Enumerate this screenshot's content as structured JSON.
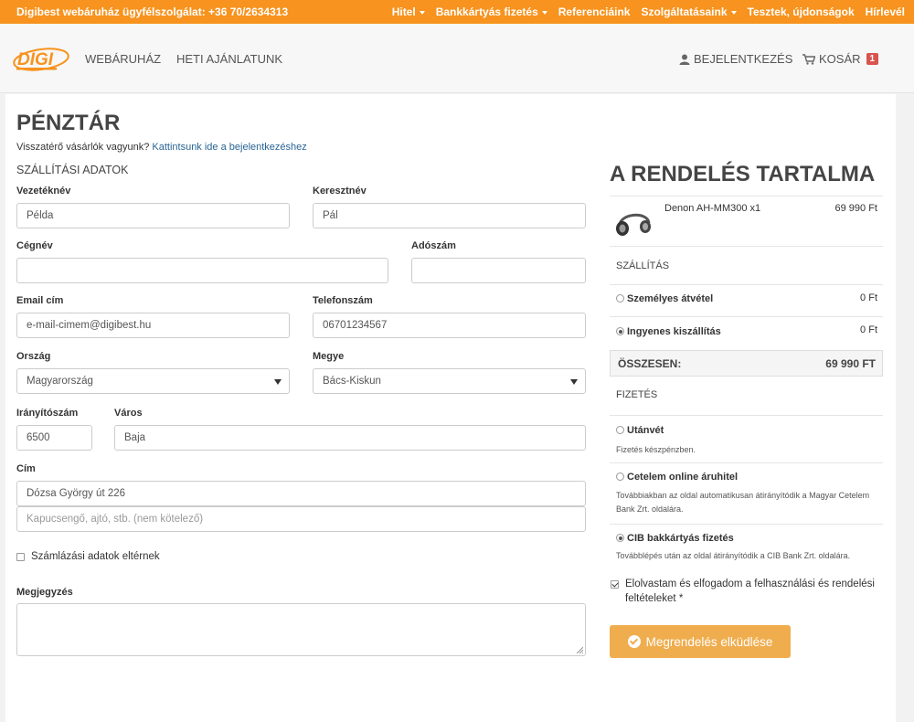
{
  "topbar": {
    "hotline": "Digibest webáruház ügyfélszolgálat: +36 70/2634313",
    "links": [
      {
        "label": "Hitel",
        "dropdown": true
      },
      {
        "label": "Bankkártyás fizetés",
        "dropdown": true
      },
      {
        "label": "Referenciáink",
        "dropdown": false
      },
      {
        "label": "Szolgáltatásaink",
        "dropdown": true
      },
      {
        "label": "Tesztek, újdonságok",
        "dropdown": false
      },
      {
        "label": "Hírlevél",
        "dropdown": false
      }
    ]
  },
  "nav": {
    "logo": "DIGI",
    "shop": "Webáruház",
    "weekly": "Heti ajánlatunk",
    "login": "Bejelentkezés",
    "cart": "Kosár",
    "cart_count": "1"
  },
  "checkout": {
    "title": "Pénztár",
    "returning_text": "Visszatérő vásárlók vagyunk?",
    "returning_link": "Kattintsunk ide a bejelentkezéshez",
    "shipping_title": "Szállítási adatok"
  },
  "form": {
    "lastname": {
      "label": "Vezetéknév",
      "value": "Példa"
    },
    "firstname": {
      "label": "Keresztnév",
      "value": "Pál"
    },
    "company": {
      "label": "Cégnév",
      "value": ""
    },
    "taxnumber": {
      "label": "Adószám",
      "value": ""
    },
    "email": {
      "label": "Email cím",
      "value": "e-mail-cimem@digibest.hu"
    },
    "phone": {
      "label": "Telefonszám",
      "value": "06701234567"
    },
    "country": {
      "label": "Ország",
      "value": "Magyarország"
    },
    "county": {
      "label": "Megye",
      "value": "Bács-Kiskun"
    },
    "zip": {
      "label": "Irányítószám",
      "value": "6500"
    },
    "city": {
      "label": "Város",
      "value": "Baja"
    },
    "address": {
      "label": "Cím",
      "value": "Dózsa György út 226",
      "placeholder2": "Kapucsengő, ajtó, stb. (nem kötelező)"
    },
    "billing_diff": "Számlázási adatok eltérnek",
    "note": {
      "label": "Megjegyzés",
      "value": ""
    }
  },
  "order": {
    "title": "A rendelés tartalma",
    "item": {
      "name": "Denon AH-MM300 x1",
      "price": "69 990 Ft"
    },
    "shipping_title": "Szállítás",
    "shipping_options": [
      {
        "label": "Személyes átvétel",
        "price": "0 Ft",
        "selected": false
      },
      {
        "label": "Ingyenes kiszállítás",
        "price": "0 Ft",
        "selected": true
      }
    ],
    "total_label": "Összesen:",
    "total_value": "69 990 Ft",
    "payment_title": "Fizetés",
    "payment_options": [
      {
        "label": "Utánvét",
        "desc": "Fizetés készpénzben.",
        "selected": false
      },
      {
        "label": "Cetelem online áruhitel",
        "desc": "Továbbiakban az oldal automatikusan átirányítódik a Magyar Cetelem Bank Zrt. oldalára.",
        "selected": false
      },
      {
        "label": "CIB bakkártyás fizetés",
        "desc": "Továbblépés után az oldal átirányítódik a CIB Bank Zrt. oldalára.",
        "selected": true
      }
    ],
    "terms": "Elolvastam és elfogadom a felhasználási és rendelési feltételeket *",
    "submit": "Megrendelés elküdlése"
  },
  "colors": {
    "accent": "#f7931e",
    "button": "#f0ad4e",
    "badge": "#d9534f",
    "link": "#2a6496"
  }
}
